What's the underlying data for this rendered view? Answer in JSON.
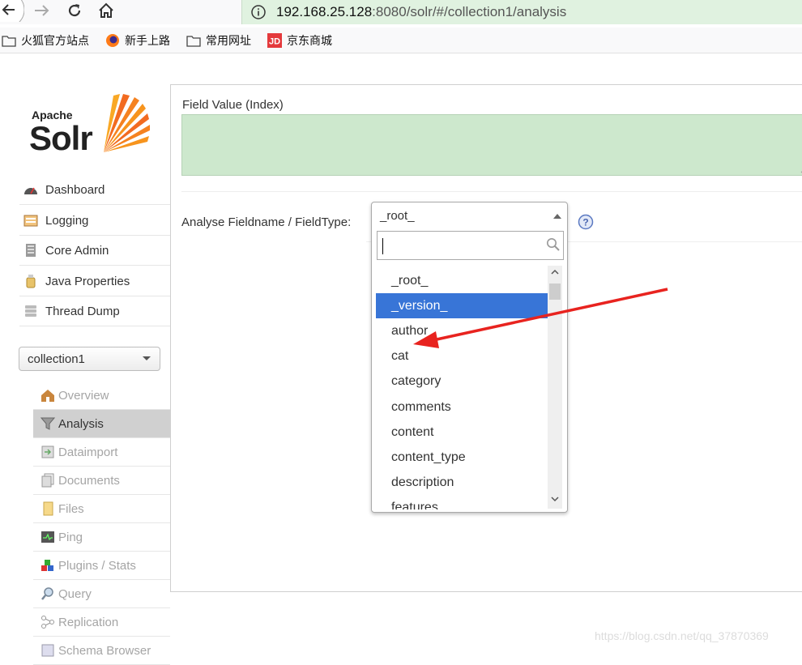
{
  "browser": {
    "url_host": "192.168.25.128",
    "url_path": ":8080/solr/#/collection1/analysis",
    "bookmarks": [
      {
        "label": "火狐官方站点"
      },
      {
        "label": "新手上路"
      },
      {
        "label": "常用网址"
      },
      {
        "label": "京东商城"
      }
    ]
  },
  "logo": {
    "apache": "Apache",
    "solr": "Solr"
  },
  "nav": {
    "items": [
      {
        "label": "Dashboard"
      },
      {
        "label": "Logging"
      },
      {
        "label": "Core Admin"
      },
      {
        "label": "Java Properties"
      },
      {
        "label": "Thread Dump"
      }
    ],
    "core_selector": "collection1",
    "core_items": [
      {
        "label": "Overview"
      },
      {
        "label": "Analysis"
      },
      {
        "label": "Dataimport"
      },
      {
        "label": "Documents"
      },
      {
        "label": "Files"
      },
      {
        "label": "Ping"
      },
      {
        "label": "Plugins / Stats"
      },
      {
        "label": "Query"
      },
      {
        "label": "Replication"
      },
      {
        "label": "Schema Browser"
      }
    ]
  },
  "analysis": {
    "field_value_label": "Field Value (Index)",
    "fieldname_label": "Analyse Fieldname / FieldType:",
    "dropdown": {
      "selected": "_root_",
      "options": [
        "_root_",
        "_version_",
        "author",
        "cat",
        "category",
        "comments",
        "content",
        "content_type",
        "description",
        "features"
      ],
      "highlighted": "_version_"
    }
  },
  "colors": {
    "url_bar": "#e0f2e0",
    "field_textarea": "#cde8cd",
    "highlight": "#3875d7",
    "arrow": "#e8231f"
  },
  "watermark": "https://blog.csdn.net/qq_37870369"
}
